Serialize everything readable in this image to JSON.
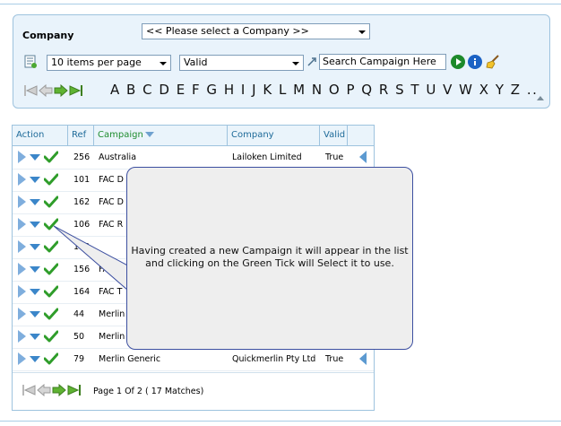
{
  "filter": {
    "company_label": "Company",
    "company_select": "<< Please select a Company >>",
    "per_page_select": "10 items per page",
    "valid_select": "Valid",
    "search_value": "Search Campaign Here",
    "alphabet": [
      "A",
      "B",
      "C",
      "D",
      "E",
      "F",
      "G",
      "H",
      "I",
      "J",
      "K",
      "L",
      "M",
      "N",
      "O",
      "P",
      "Q",
      "R",
      "S",
      "T",
      "U",
      "V",
      "W",
      "X",
      "Y",
      "Z",
      ".."
    ]
  },
  "grid": {
    "headers": {
      "action": "Action",
      "ref": "Ref",
      "campaign": "Campaign",
      "company": "Company",
      "valid": "Valid"
    },
    "rows": [
      {
        "ref": "256",
        "campaign": "Australia",
        "company": "Lailoken Limited",
        "valid": "True"
      },
      {
        "ref": "101",
        "campaign": "FAC D",
        "company": "",
        "valid": ""
      },
      {
        "ref": "162",
        "campaign": "FAC D",
        "company": "",
        "valid": ""
      },
      {
        "ref": "106",
        "campaign": "FAC R",
        "company": "",
        "valid": ""
      },
      {
        "ref": "100",
        "campaign": "",
        "company": "",
        "valid": ""
      },
      {
        "ref": "156",
        "campaign": "FAC",
        "company": "",
        "valid": ""
      },
      {
        "ref": "164",
        "campaign": "FAC T",
        "company": "",
        "valid": ""
      },
      {
        "ref": "44",
        "campaign": "Merlin",
        "company": "",
        "valid": ""
      },
      {
        "ref": "50",
        "campaign": "Merlin",
        "company": "",
        "valid": ""
      },
      {
        "ref": "79",
        "campaign": "Merlin Generic",
        "company": "Quickmerlin Pty Ltd",
        "valid": "True"
      }
    ],
    "pager_text": "Page 1 Of 2 ( 17 Matches)"
  },
  "callout": {
    "line1": "Having created a new Campaign it will appear in the list",
    "line2": "and clicking on the Green Tick will Select it to use."
  },
  "colors": {
    "panel_bg": "#e9f3fb",
    "border": "#9ec3de",
    "header_text": "#1e6a99",
    "campaign_header": "#1f8d2f",
    "tick_green": "#2f9d2a",
    "callout_border": "#3c4fa0"
  }
}
